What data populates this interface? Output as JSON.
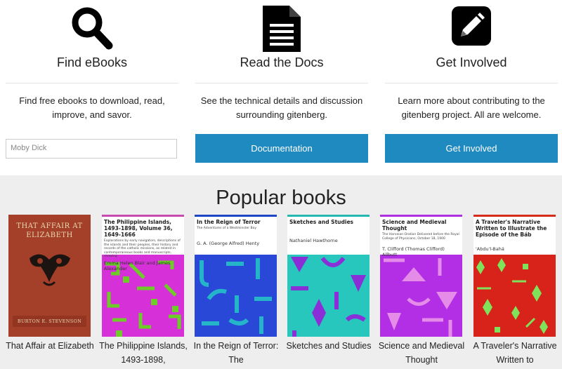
{
  "features": [
    {
      "icon": "search-icon",
      "title": "Find eBooks",
      "desc": "Find free ebooks to download, read, improve, and savor."
    },
    {
      "icon": "document-icon",
      "title": "Read the Docs",
      "desc": "See the technical details and discussion surrounding gitenberg."
    },
    {
      "icon": "edit-icon",
      "title": "Get Involved",
      "desc": "Learn more about contributing to the gitenberg project. All are welcome."
    }
  ],
  "search": {
    "placeholder": "Moby Dick"
  },
  "buttons": {
    "docs": "Documentation",
    "involved": "Get Involved"
  },
  "popular": {
    "heading": "Popular books",
    "books": [
      {
        "title": "That Affair at Elizabeth",
        "cover_title": "THAT AFFAIR AT ELIZABETH",
        "cover_author": "BURTON E. STEVENSON"
      },
      {
        "title": "The Philippine Islands, 1493-1898,",
        "cover_title": "The Philippine Islands, 1493-1898, Volume 36, 1649-1666",
        "cover_subtitle": "Explorations by early navigators, descriptions of the islands and their peoples, their history and records of the catholic missions, as related in contemporaneous books and manuscripts, showing",
        "cover_author": "Emma Helen Blair and James Alexander",
        "accent": "#c84bb0"
      },
      {
        "title": "In the Reign of Terror: The",
        "cover_title": "In the Reign of Terror",
        "cover_subtitle": "The Adventures of a Westminster Boy",
        "cover_author": "G. A. (George Alfred) Henty",
        "accent": "#1c46c6"
      },
      {
        "title": "Sketches and Studies",
        "cover_title": "Sketches and Studies",
        "cover_author": "Nathaniel Hawthorne",
        "accent": "#25b8b0"
      },
      {
        "title": "Science and Medieval Thought",
        "cover_title": "Science and Medieval Thought",
        "cover_subtitle": "The Harveian Oration Delivered before the Royal College of Physicians, October 18, 1900",
        "cover_author": "T. Clifford (Thomas Clifford) Allbutt",
        "accent": "#b02fe0"
      },
      {
        "title": "A Traveler's Narrative Written to",
        "cover_title": "A Traveler's Narrative Written to Illustrate the Episode of the Báb",
        "cover_author": "'Abdu'l-Bahá",
        "accent": "#d62a1a"
      }
    ]
  },
  "colors": {
    "button": "#1f8ac0",
    "band": "#eeeeee"
  }
}
